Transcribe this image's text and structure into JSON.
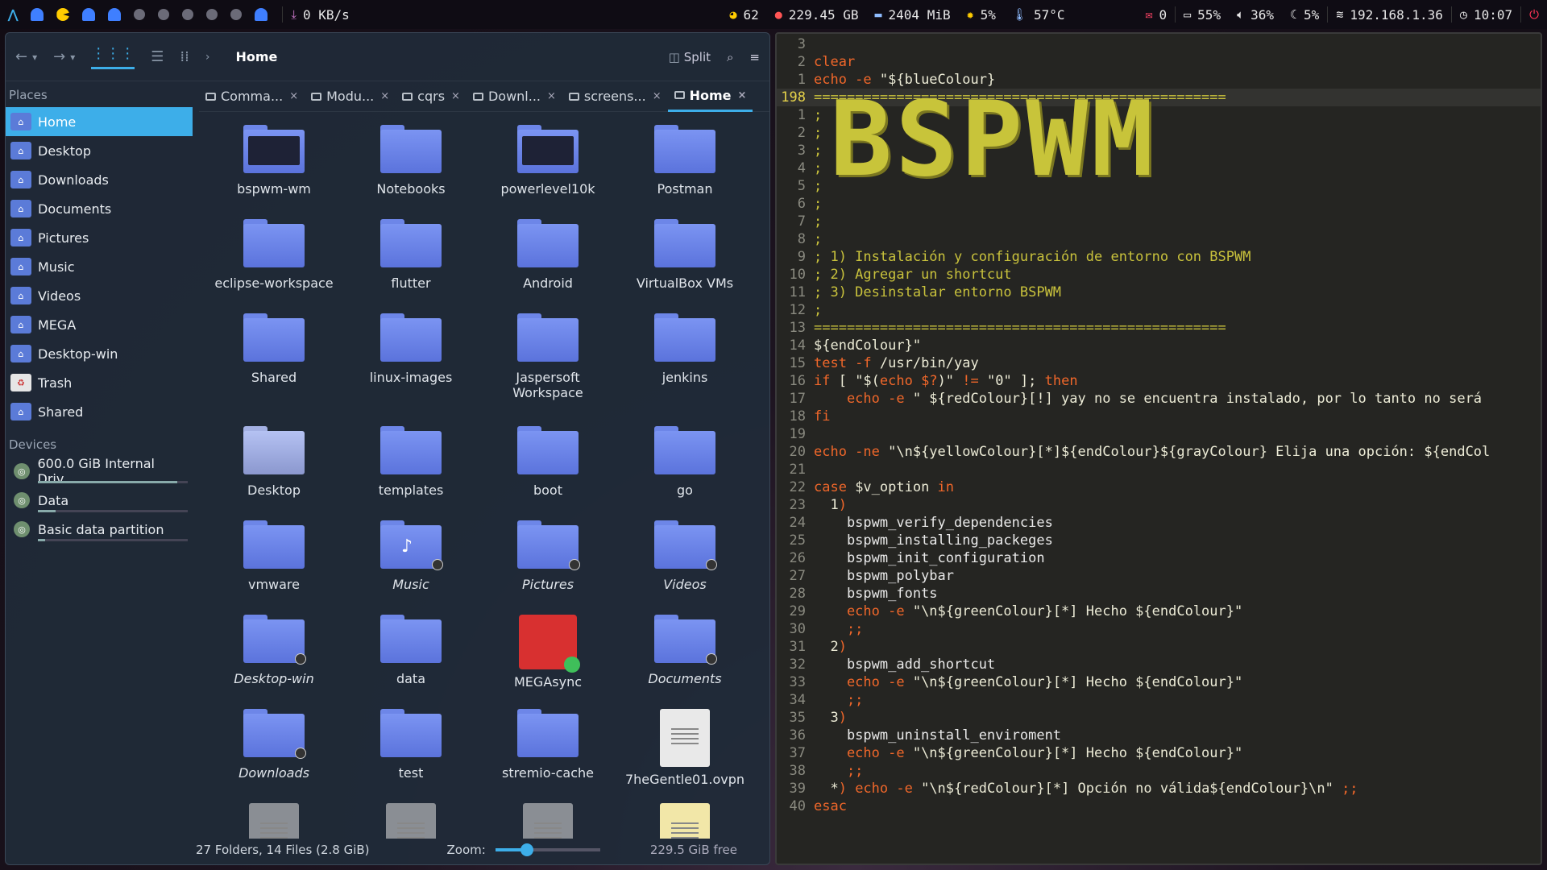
{
  "topbar": {
    "net": "0 KB/s",
    "updates": "62",
    "disk": "229.45 GB",
    "ram": "2404 MiB",
    "cpu": "5%",
    "temp": "57°C",
    "mail": "0",
    "battery": "55%",
    "volume": "36%",
    "brightness": "5%",
    "ip": "192.168.1.36",
    "time": "10:07"
  },
  "fm": {
    "breadcrumb": "Home",
    "split_label": "Split",
    "places_header": "Places",
    "devices_header": "Devices",
    "places": [
      {
        "label": "Home"
      },
      {
        "label": "Desktop"
      },
      {
        "label": "Downloads"
      },
      {
        "label": "Documents"
      },
      {
        "label": "Pictures"
      },
      {
        "label": "Music"
      },
      {
        "label": "Videos"
      },
      {
        "label": "MEGA"
      },
      {
        "label": "Desktop-win"
      },
      {
        "label": "Trash"
      },
      {
        "label": "Shared"
      }
    ],
    "devices": [
      {
        "label": "600.0 GiB Internal Driv...",
        "used": 0.93
      },
      {
        "label": "Data",
        "used": 0.12
      },
      {
        "label": "Basic data partition",
        "used": 0.05
      }
    ],
    "tabs": [
      "Comma...",
      "Modu...",
      "cqrs",
      "Downl...",
      "screens...",
      "Home"
    ],
    "items": [
      {
        "label": "bspwm-wm",
        "kind": "folder-thumb"
      },
      {
        "label": "Notebooks",
        "kind": "folder"
      },
      {
        "label": "powerlevel10k",
        "kind": "folder-thumb"
      },
      {
        "label": "Postman",
        "kind": "folder"
      },
      {
        "label": "eclipse-workspace",
        "kind": "folder"
      },
      {
        "label": "flutter",
        "kind": "folder"
      },
      {
        "label": "Android",
        "kind": "folder"
      },
      {
        "label": "VirtualBox VMs",
        "kind": "folder"
      },
      {
        "label": "Shared",
        "kind": "folder"
      },
      {
        "label": "linux-images",
        "kind": "folder"
      },
      {
        "label": "Jaspersoft Workspace",
        "kind": "folder"
      },
      {
        "label": "jenkins",
        "kind": "folder"
      },
      {
        "label": "Desktop",
        "kind": "folder-doc"
      },
      {
        "label": "templates",
        "kind": "folder"
      },
      {
        "label": "boot",
        "kind": "folder"
      },
      {
        "label": "go",
        "kind": "folder"
      },
      {
        "label": "vmware",
        "kind": "folder"
      },
      {
        "label": "Music",
        "kind": "link-music"
      },
      {
        "label": "Pictures",
        "kind": "link"
      },
      {
        "label": "Videos",
        "kind": "link"
      },
      {
        "label": "Desktop-win",
        "kind": "link"
      },
      {
        "label": "data",
        "kind": "folder"
      },
      {
        "label": "MEGAsync",
        "kind": "mega"
      },
      {
        "label": "Documents",
        "kind": "link"
      },
      {
        "label": "Downloads",
        "kind": "link"
      },
      {
        "label": "test",
        "kind": "folder"
      },
      {
        "label": "stremio-cache",
        "kind": "folder"
      },
      {
        "label": "7heGentle01.ovpn",
        "kind": "file"
      }
    ],
    "status_text": "27 Folders, 14 Files (2.8 GiB)",
    "zoom_label": "Zoom:",
    "zoom_level": 0.3,
    "free_text": "229.5 GiB free"
  },
  "term": {
    "ascii": "BSPWM",
    "lines": [
      {
        "n": "3",
        "t": []
      },
      {
        "n": "2",
        "t": [
          [
            "c-kw",
            "clear"
          ]
        ]
      },
      {
        "n": "1",
        "t": [
          [
            "c-kw",
            "echo -e "
          ],
          [
            "c-s",
            "\"${blueColour}"
          ]
        ]
      },
      {
        "n": "198",
        "cur": true,
        "t": [
          [
            "c-c",
            "=================================================="
          ]
        ]
      },
      {
        "n": "1",
        "t": [
          [
            "c-c",
            ";"
          ]
        ]
      },
      {
        "n": "2",
        "t": [
          [
            "c-c",
            ";"
          ]
        ]
      },
      {
        "n": "3",
        "t": [
          [
            "c-c",
            ";"
          ]
        ]
      },
      {
        "n": "4",
        "t": [
          [
            "c-c",
            ";"
          ]
        ]
      },
      {
        "n": "5",
        "t": [
          [
            "c-c",
            ";"
          ]
        ]
      },
      {
        "n": "6",
        "t": [
          [
            "c-c",
            ";"
          ]
        ]
      },
      {
        "n": "7",
        "t": [
          [
            "c-c",
            ";"
          ]
        ]
      },
      {
        "n": "8",
        "t": [
          [
            "c-c",
            ";"
          ]
        ]
      },
      {
        "n": "9",
        "t": [
          [
            "c-c",
            "; 1) Instalación y configuración de entorno con BSPWM"
          ]
        ]
      },
      {
        "n": "10",
        "t": [
          [
            "c-c",
            "; 2) Agregar un shortcut"
          ]
        ]
      },
      {
        "n": "11",
        "t": [
          [
            "c-c",
            "; 3) Desinstalar entorno BSPWM"
          ]
        ]
      },
      {
        "n": "12",
        "t": [
          [
            "c-c",
            ";"
          ]
        ]
      },
      {
        "n": "13",
        "t": [
          [
            "c-c",
            "=================================================="
          ]
        ]
      },
      {
        "n": "14",
        "t": [
          [
            "c-s",
            "${endColour}\""
          ]
        ]
      },
      {
        "n": "15",
        "t": [
          [
            "c-kw",
            "test -f "
          ],
          [
            "c-s",
            "/usr/bin/yay"
          ]
        ]
      },
      {
        "n": "16",
        "t": [
          [
            "c-kw",
            "if "
          ],
          [
            "c-s",
            "[ \"$("
          ],
          [
            "c-kw",
            "echo $?"
          ],
          [
            "c-s",
            ")\" "
          ],
          [
            "c-kw",
            "!= "
          ],
          [
            "c-s",
            "\"0\" ]; "
          ],
          [
            "c-kw",
            "then"
          ]
        ]
      },
      {
        "n": "17",
        "t": [
          [
            "c-kw",
            "    echo -e "
          ],
          [
            "c-s",
            "\" ${redColour}[!] yay no se encuentra instalado, por lo tanto no será"
          ]
        ]
      },
      {
        "n": "18",
        "t": [
          [
            "c-kw",
            "fi"
          ]
        ]
      },
      {
        "n": "19",
        "t": []
      },
      {
        "n": "20",
        "t": [
          [
            "c-kw",
            "echo -ne "
          ],
          [
            "c-s",
            "\"\\n${yellowColour}[*]${endColour}${grayColour} Elija una opción: ${endCol"
          ]
        ]
      },
      {
        "n": "21",
        "t": []
      },
      {
        "n": "22",
        "t": [
          [
            "c-kw",
            "case "
          ],
          [
            "c-s",
            "$v_option "
          ],
          [
            "c-kw",
            "in"
          ]
        ]
      },
      {
        "n": "23",
        "t": [
          [
            "c-s",
            "  1"
          ],
          [
            "c-kw",
            ")"
          ]
        ]
      },
      {
        "n": "24",
        "t": [
          [
            "c-w",
            "    bspwm_verify_dependencies"
          ]
        ]
      },
      {
        "n": "25",
        "t": [
          [
            "c-w",
            "    bspwm_installing_packeges"
          ]
        ]
      },
      {
        "n": "26",
        "t": [
          [
            "c-w",
            "    bspwm_init_configuration"
          ]
        ]
      },
      {
        "n": "27",
        "t": [
          [
            "c-w",
            "    bspwm_polybar"
          ]
        ]
      },
      {
        "n": "28",
        "t": [
          [
            "c-w",
            "    bspwm_fonts"
          ]
        ]
      },
      {
        "n": "29",
        "t": [
          [
            "c-kw",
            "    echo -e "
          ],
          [
            "c-s",
            "\"\\n${greenColour}[*] Hecho ${endColour}\""
          ]
        ]
      },
      {
        "n": "30",
        "t": [
          [
            "c-kw",
            "    ;;"
          ]
        ]
      },
      {
        "n": "31",
        "t": [
          [
            "c-s",
            "  2"
          ],
          [
            "c-kw",
            ")"
          ]
        ]
      },
      {
        "n": "32",
        "t": [
          [
            "c-w",
            "    bspwm_add_shortcut"
          ]
        ]
      },
      {
        "n": "33",
        "t": [
          [
            "c-kw",
            "    echo -e "
          ],
          [
            "c-s",
            "\"\\n${greenColour}[*] Hecho ${endColour}\""
          ]
        ]
      },
      {
        "n": "34",
        "t": [
          [
            "c-kw",
            "    ;;"
          ]
        ]
      },
      {
        "n": "35",
        "t": [
          [
            "c-s",
            "  3"
          ],
          [
            "c-kw",
            ")"
          ]
        ]
      },
      {
        "n": "36",
        "t": [
          [
            "c-w",
            "    bspwm_uninstall_enviroment"
          ]
        ]
      },
      {
        "n": "37",
        "t": [
          [
            "c-kw",
            "    echo -e "
          ],
          [
            "c-s",
            "\"\\n${greenColour}[*] Hecho ${endColour}\""
          ]
        ]
      },
      {
        "n": "38",
        "t": [
          [
            "c-kw",
            "    ;;"
          ]
        ]
      },
      {
        "n": "39",
        "t": [
          [
            "c-s",
            "  *"
          ],
          [
            "c-kw",
            ") echo -e "
          ],
          [
            "c-s",
            "\"\\n${redColour}[*] Opción no válida${endColour}\\n\" "
          ],
          [
            "c-kw",
            ";;"
          ]
        ]
      },
      {
        "n": "40",
        "t": [
          [
            "c-kw",
            "esac"
          ]
        ]
      }
    ]
  }
}
